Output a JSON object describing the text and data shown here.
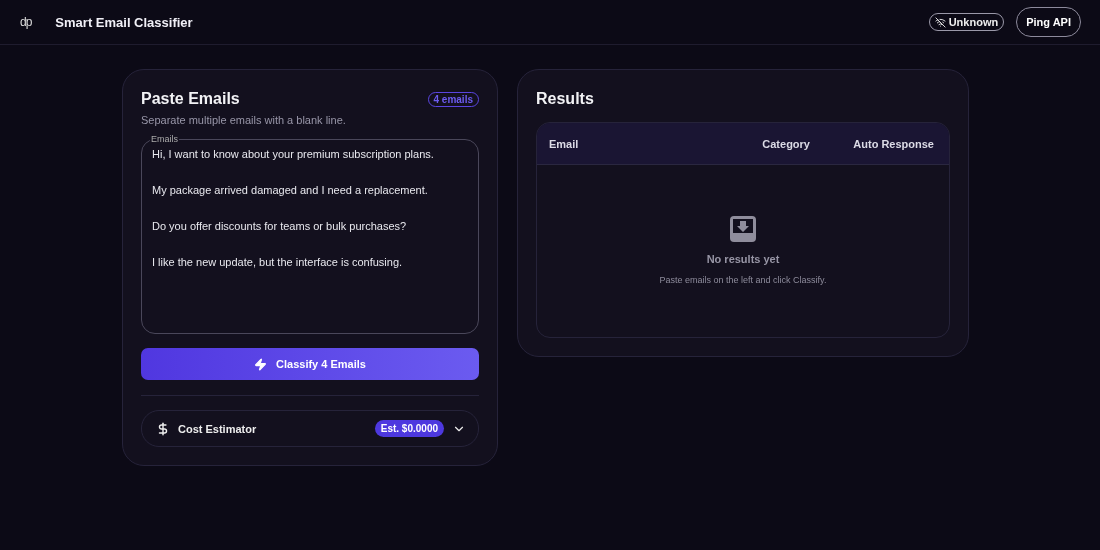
{
  "header": {
    "logo": "dp",
    "title": "Smart Email Classifier",
    "status": {
      "label": "Unknown",
      "connected": false
    },
    "ping_button": "Ping API"
  },
  "input_panel": {
    "title": "Paste Emails",
    "count_badge": "4 emails",
    "subtitle": "Separate multiple emails with a blank line.",
    "field_label": "Emails",
    "emails": [
      "Hi, I want to know about your premium subscription plans.",
      "My package arrived damaged and I need a replacement.",
      "Do you offer discounts for teams or bulk purchases?",
      "I like the new update, but the interface is confusing."
    ],
    "classify_button": "Classify 4 Emails",
    "cost_estimator": {
      "label": "Cost Estimator",
      "estimate": "Est. $0.0000",
      "expanded": false
    }
  },
  "results_panel": {
    "title": "Results",
    "columns": [
      "Email",
      "Category",
      "Auto Response"
    ],
    "empty_title": "No results yet",
    "empty_hint": "Paste emails on the left and click Classify."
  }
}
